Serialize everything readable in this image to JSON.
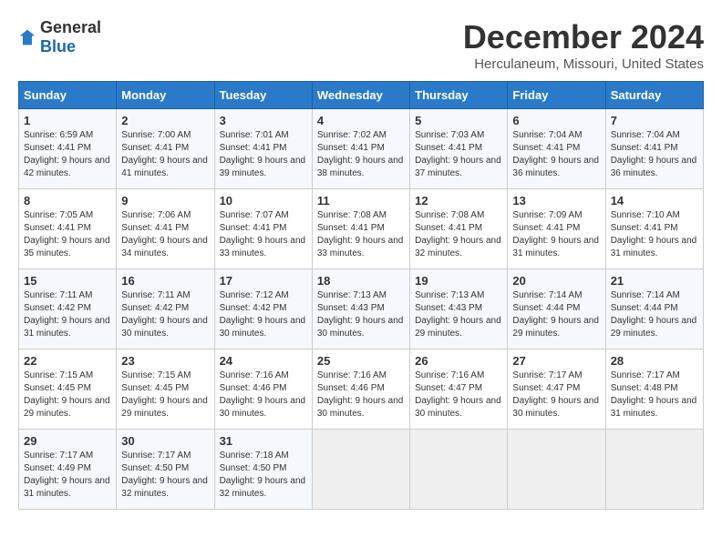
{
  "logo": {
    "general": "General",
    "blue": "Blue"
  },
  "title": "December 2024",
  "location": "Herculaneum, Missouri, United States",
  "days_header": [
    "Sunday",
    "Monday",
    "Tuesday",
    "Wednesday",
    "Thursday",
    "Friday",
    "Saturday"
  ],
  "weeks": [
    [
      {
        "day": "1",
        "sunrise": "6:59 AM",
        "sunset": "4:41 PM",
        "daylight": "9 hours and 42 minutes."
      },
      {
        "day": "2",
        "sunrise": "7:00 AM",
        "sunset": "4:41 PM",
        "daylight": "9 hours and 41 minutes."
      },
      {
        "day": "3",
        "sunrise": "7:01 AM",
        "sunset": "4:41 PM",
        "daylight": "9 hours and 39 minutes."
      },
      {
        "day": "4",
        "sunrise": "7:02 AM",
        "sunset": "4:41 PM",
        "daylight": "9 hours and 38 minutes."
      },
      {
        "day": "5",
        "sunrise": "7:03 AM",
        "sunset": "4:41 PM",
        "daylight": "9 hours and 37 minutes."
      },
      {
        "day": "6",
        "sunrise": "7:04 AM",
        "sunset": "4:41 PM",
        "daylight": "9 hours and 36 minutes."
      },
      {
        "day": "7",
        "sunrise": "7:04 AM",
        "sunset": "4:41 PM",
        "daylight": "9 hours and 36 minutes."
      }
    ],
    [
      {
        "day": "8",
        "sunrise": "7:05 AM",
        "sunset": "4:41 PM",
        "daylight": "9 hours and 35 minutes."
      },
      {
        "day": "9",
        "sunrise": "7:06 AM",
        "sunset": "4:41 PM",
        "daylight": "9 hours and 34 minutes."
      },
      {
        "day": "10",
        "sunrise": "7:07 AM",
        "sunset": "4:41 PM",
        "daylight": "9 hours and 33 minutes."
      },
      {
        "day": "11",
        "sunrise": "7:08 AM",
        "sunset": "4:41 PM",
        "daylight": "9 hours and 33 minutes."
      },
      {
        "day": "12",
        "sunrise": "7:08 AM",
        "sunset": "4:41 PM",
        "daylight": "9 hours and 32 minutes."
      },
      {
        "day": "13",
        "sunrise": "7:09 AM",
        "sunset": "4:41 PM",
        "daylight": "9 hours and 31 minutes."
      },
      {
        "day": "14",
        "sunrise": "7:10 AM",
        "sunset": "4:41 PM",
        "daylight": "9 hours and 31 minutes."
      }
    ],
    [
      {
        "day": "15",
        "sunrise": "7:11 AM",
        "sunset": "4:42 PM",
        "daylight": "9 hours and 31 minutes."
      },
      {
        "day": "16",
        "sunrise": "7:11 AM",
        "sunset": "4:42 PM",
        "daylight": "9 hours and 30 minutes."
      },
      {
        "day": "17",
        "sunrise": "7:12 AM",
        "sunset": "4:42 PM",
        "daylight": "9 hours and 30 minutes."
      },
      {
        "day": "18",
        "sunrise": "7:13 AM",
        "sunset": "4:43 PM",
        "daylight": "9 hours and 30 minutes."
      },
      {
        "day": "19",
        "sunrise": "7:13 AM",
        "sunset": "4:43 PM",
        "daylight": "9 hours and 29 minutes."
      },
      {
        "day": "20",
        "sunrise": "7:14 AM",
        "sunset": "4:44 PM",
        "daylight": "9 hours and 29 minutes."
      },
      {
        "day": "21",
        "sunrise": "7:14 AM",
        "sunset": "4:44 PM",
        "daylight": "9 hours and 29 minutes."
      }
    ],
    [
      {
        "day": "22",
        "sunrise": "7:15 AM",
        "sunset": "4:45 PM",
        "daylight": "9 hours and 29 minutes."
      },
      {
        "day": "23",
        "sunrise": "7:15 AM",
        "sunset": "4:45 PM",
        "daylight": "9 hours and 29 minutes."
      },
      {
        "day": "24",
        "sunrise": "7:16 AM",
        "sunset": "4:46 PM",
        "daylight": "9 hours and 30 minutes."
      },
      {
        "day": "25",
        "sunrise": "7:16 AM",
        "sunset": "4:46 PM",
        "daylight": "9 hours and 30 minutes."
      },
      {
        "day": "26",
        "sunrise": "7:16 AM",
        "sunset": "4:47 PM",
        "daylight": "9 hours and 30 minutes."
      },
      {
        "day": "27",
        "sunrise": "7:17 AM",
        "sunset": "4:47 PM",
        "daylight": "9 hours and 30 minutes."
      },
      {
        "day": "28",
        "sunrise": "7:17 AM",
        "sunset": "4:48 PM",
        "daylight": "9 hours and 31 minutes."
      }
    ],
    [
      {
        "day": "29",
        "sunrise": "7:17 AM",
        "sunset": "4:49 PM",
        "daylight": "9 hours and 31 minutes."
      },
      {
        "day": "30",
        "sunrise": "7:17 AM",
        "sunset": "4:50 PM",
        "daylight": "9 hours and 32 minutes."
      },
      {
        "day": "31",
        "sunrise": "7:18 AM",
        "sunset": "4:50 PM",
        "daylight": "9 hours and 32 minutes."
      },
      null,
      null,
      null,
      null
    ]
  ]
}
